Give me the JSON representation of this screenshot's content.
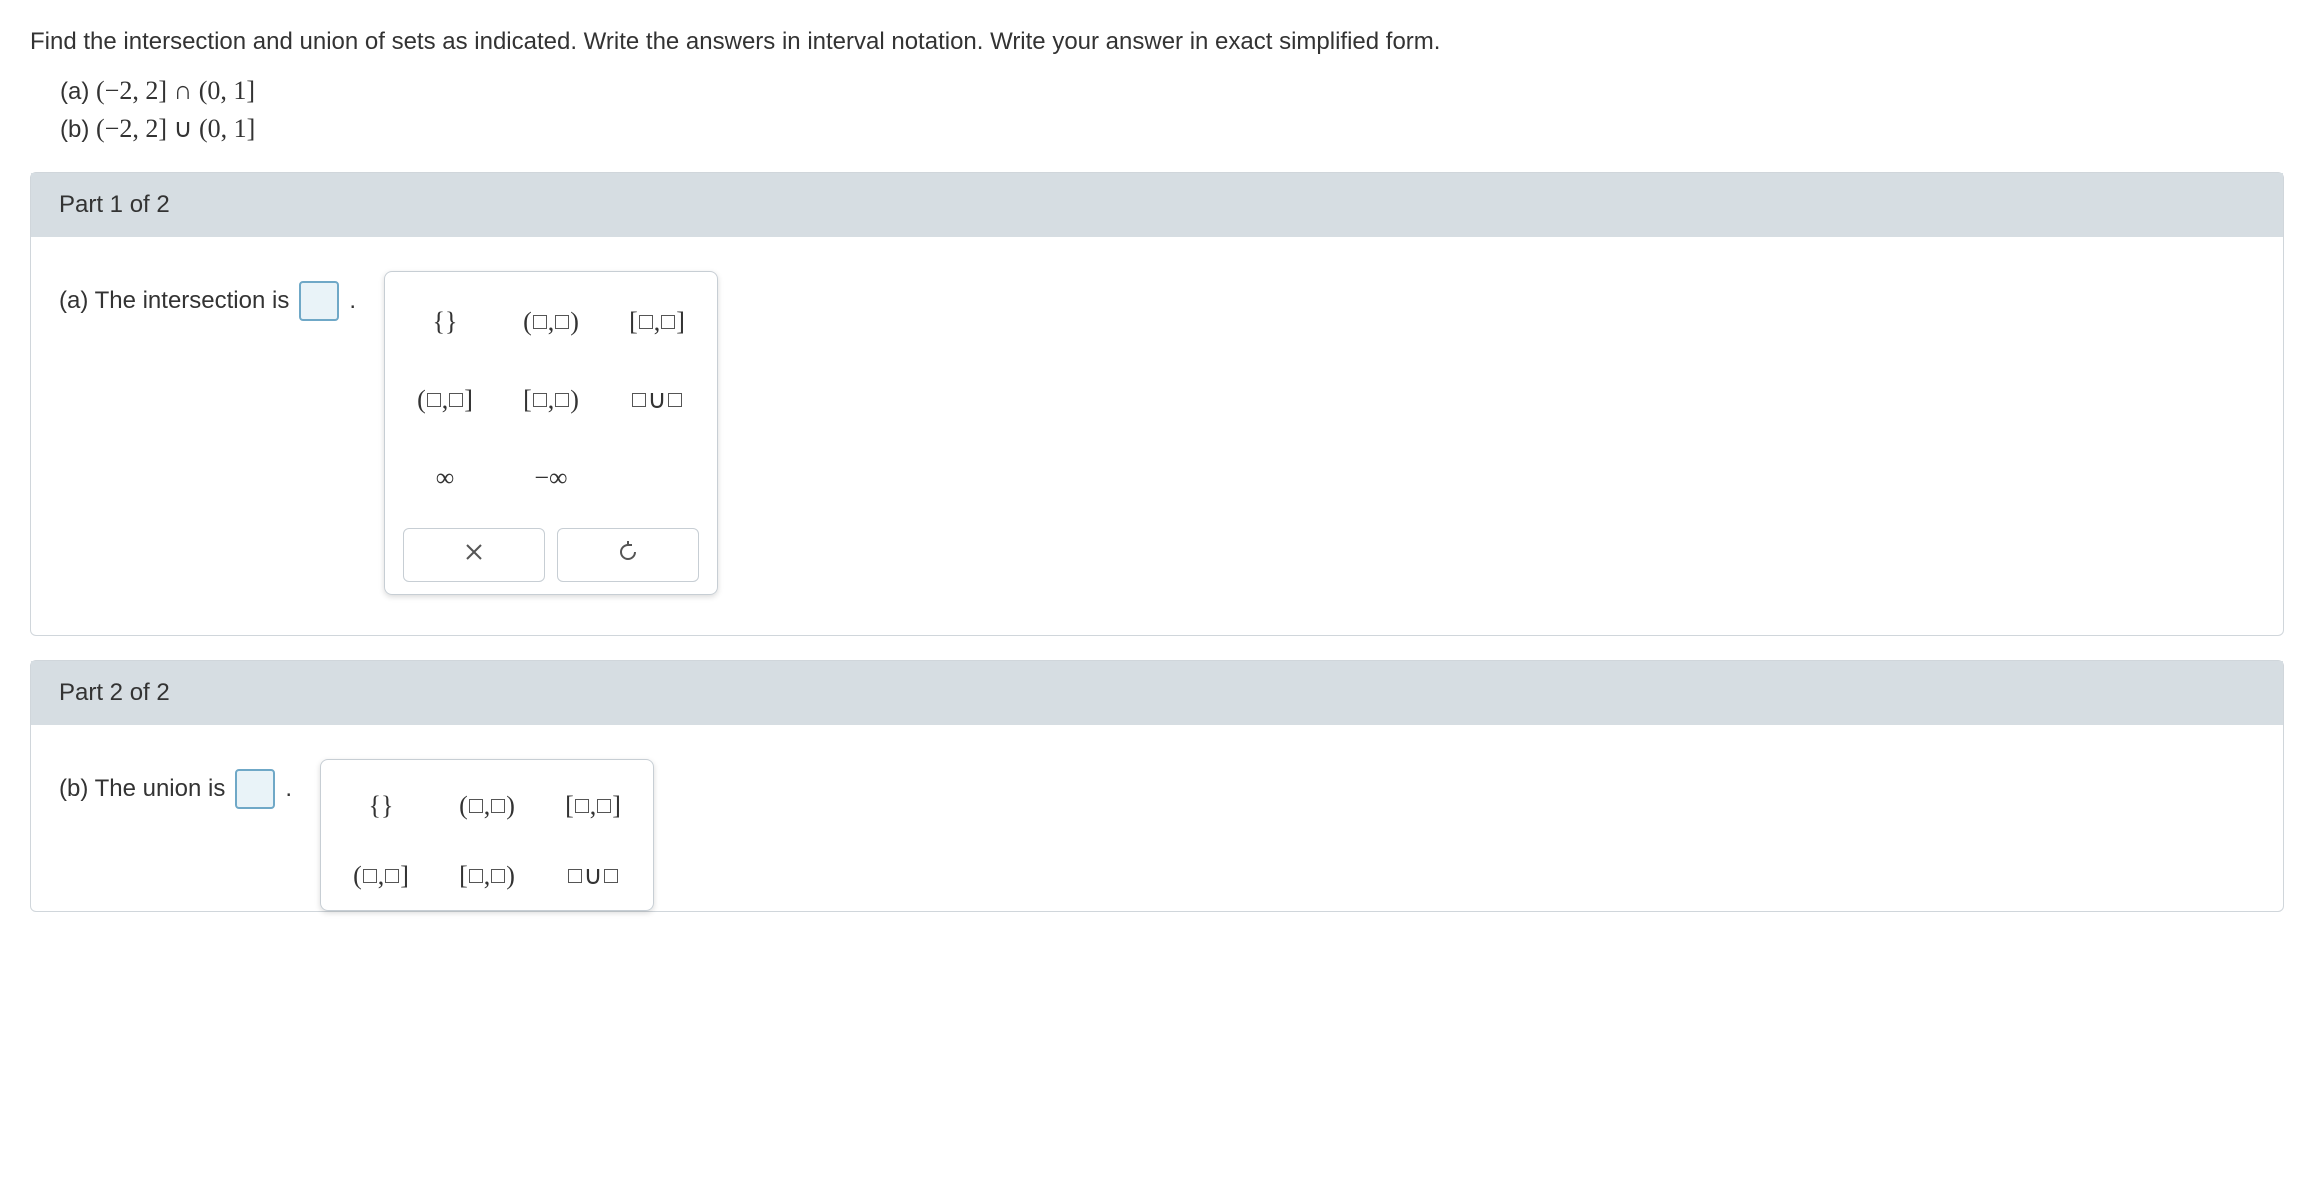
{
  "question": {
    "prompt": "Find the intersection and union of sets as indicated. Write the answers in interval notation. Write your answer in exact simplified form.",
    "sub_a_label": "(a) ",
    "sub_a_math": "(−2, 2] ∩ (0, 1]",
    "sub_b_label": "(b) ",
    "sub_b_math": "(−2, 2] ∪ (0, 1]"
  },
  "part1": {
    "header": "Part 1 of 2",
    "line": "(a) The intersection is"
  },
  "part2": {
    "header": "Part 2 of 2",
    "line": "(b) The union is"
  },
  "keypad": {
    "empty_set": "{}",
    "open_open": "(□,□)",
    "closed_closed": "[□,□]",
    "open_closed": "(□,□]",
    "closed_open": "[□,□)",
    "union": "□∪□",
    "infinity": "∞",
    "neg_infinity": "−∞",
    "clear": "×",
    "reset": "↺"
  }
}
